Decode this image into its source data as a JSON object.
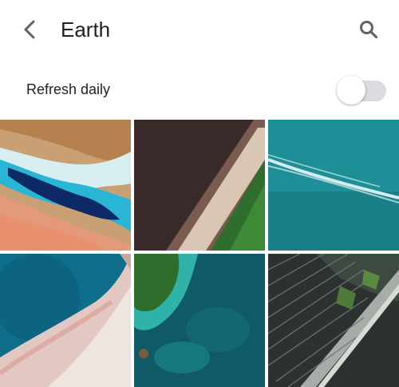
{
  "appbar": {
    "title": "Earth",
    "back_icon": "arrow-back-icon",
    "search_icon": "search-icon"
  },
  "settings": {
    "refresh_daily_label": "Refresh daily",
    "refresh_daily_enabled": false
  },
  "wallpapers": [
    {
      "name": "wallpaper-desert-coast"
    },
    {
      "name": "wallpaper-dune-ridge"
    },
    {
      "name": "wallpaper-teal-water"
    },
    {
      "name": "wallpaper-lagoon-sandbar"
    },
    {
      "name": "wallpaper-reef-island"
    },
    {
      "name": "wallpaper-city-fields"
    }
  ]
}
